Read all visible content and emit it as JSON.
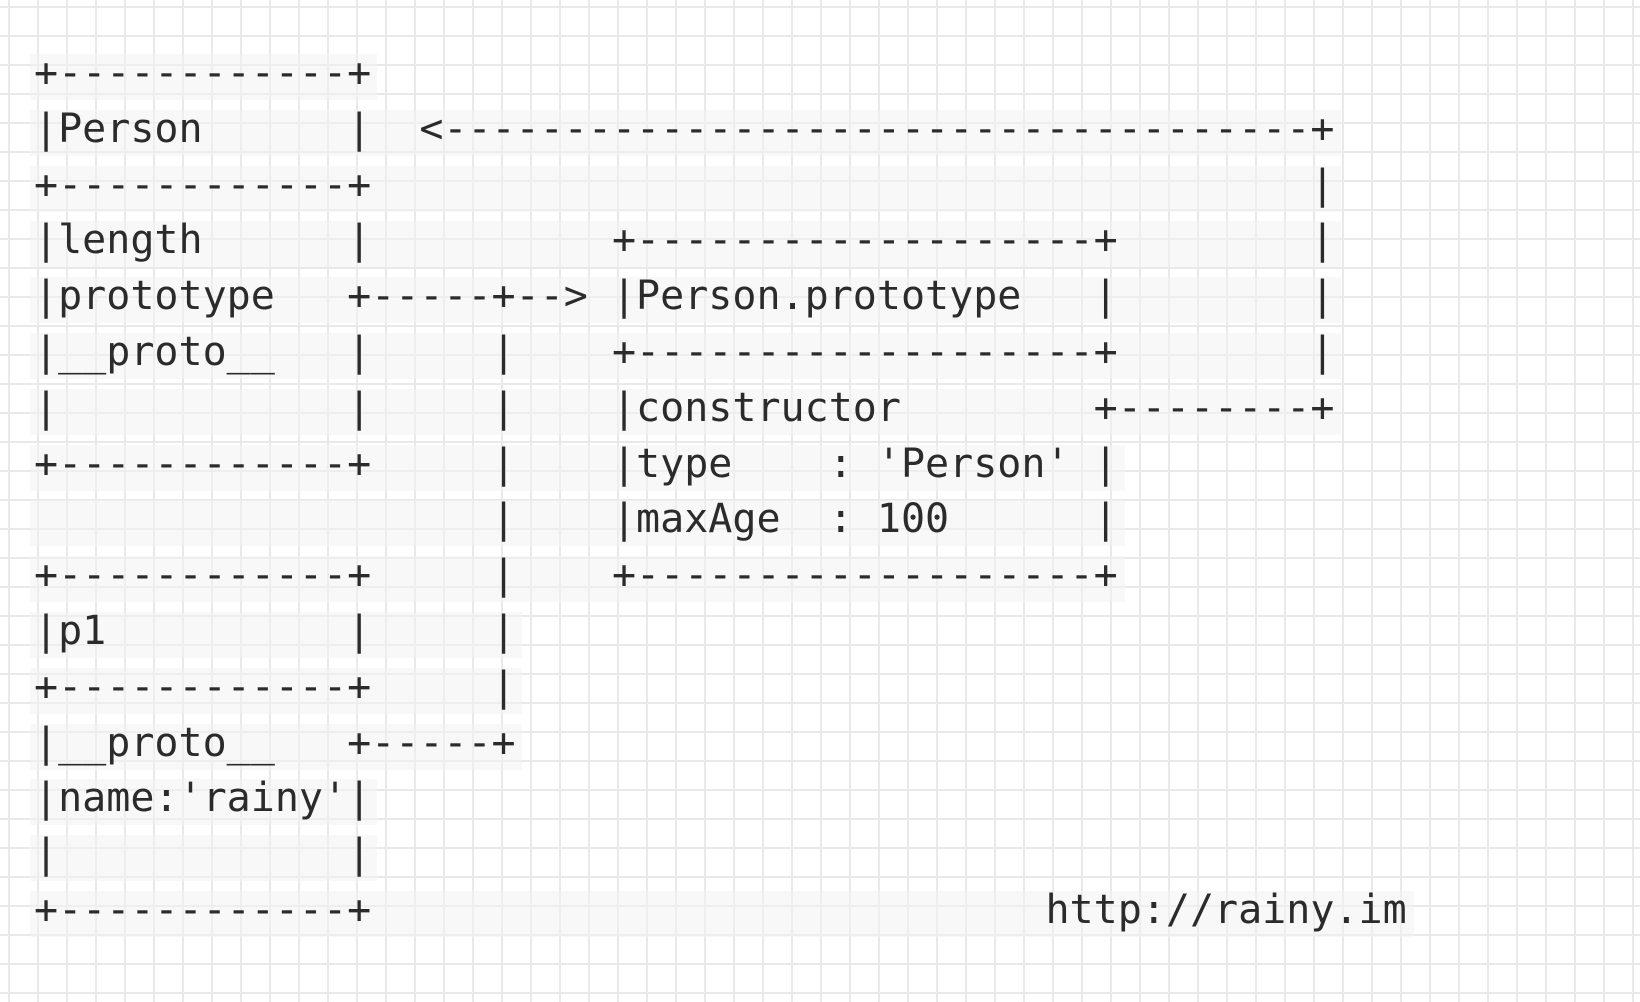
{
  "diagram": {
    "lines": [
      "+------------+",
      "|Person      |  <------------------------------------+",
      "+------------+                                       |",
      "|length      |          +-------------------+        |",
      "|prototype   +-----+--> |Person.prototype   |        |",
      "|__proto__   |     |    +-------------------+        |",
      "|            |     |    |constructor        +--------+",
      "+------------+     |    |type    : 'Person' |",
      "                   |    |maxAge  : 100      |",
      "+------------+     |    +-------------------+",
      "|p1          |     |",
      "+------------+     |",
      "|__proto__   +-----+",
      "|name:'rainy'|",
      "|            |",
      "+------------+                            http://rainy.im"
    ],
    "labels": {
      "person_title": "Person",
      "person_fields": [
        "length",
        "prototype",
        "__proto__"
      ],
      "prototype_title": "Person.prototype",
      "prototype_fields": [
        "constructor",
        "type    : 'Person'",
        "maxAge  : 100"
      ],
      "instance_title": "p1",
      "instance_fields": [
        "__proto__",
        "name:'rainy'"
      ],
      "footer_url": "http://rainy.im"
    }
  }
}
